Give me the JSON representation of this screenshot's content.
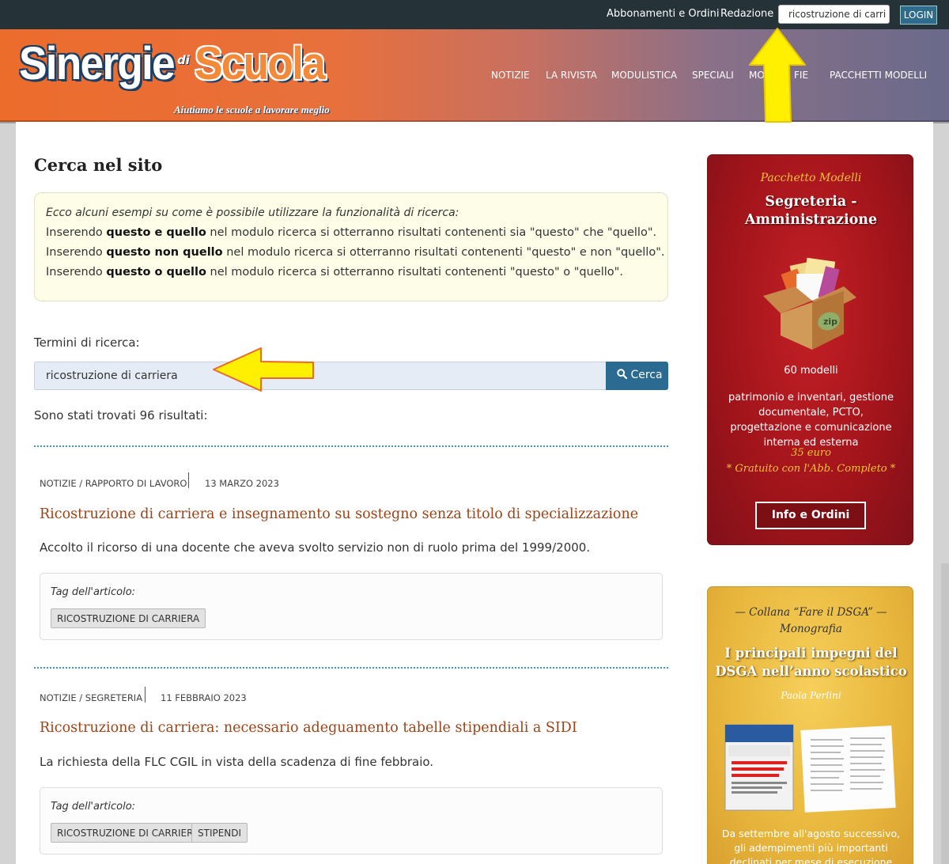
{
  "topbar": {
    "link_subscriptions": "Abbonamenti e Ordini",
    "link_editorial": "Redazione",
    "search_value": "ricostruzione di carri",
    "login_label": "LOGIN"
  },
  "logo": {
    "word1": "Sinergie",
    "word2": "di",
    "word3": "Scuola",
    "tagline": "Aiutiamo le scuole a lavorare meglio"
  },
  "nav": {
    "items": [
      "NOTIZIE",
      "LA RIVISTA",
      "MODULISTICA",
      "SPECIALI",
      "MO",
      "FIE",
      "PACCHETTI MODELLI"
    ]
  },
  "main": {
    "title": "Cerca nel sito",
    "hint": {
      "intro": "Ecco alcuni esempi su come è possibile utilizzare la funzionalità di ricerca:",
      "lines": [
        {
          "pre": "Inserendo ",
          "bold": "questo e quello",
          "post": " nel modulo ricerca si otterranno risultati contenenti sia \"questo\" che \"quello\"."
        },
        {
          "pre": "Inserendo ",
          "bold": "questo non quello",
          "post": " nel modulo ricerca si otterranno risultati contenenti \"questo\" e non \"quello\"."
        },
        {
          "pre": "Inserendo ",
          "bold": "questo o quello",
          "post": " nel modulo ricerca si otterranno risultati contenenti \"questo\" o \"quello\"."
        }
      ]
    },
    "search_label": "Termini di ricerca:",
    "search_value": "ricostruzione di carriera",
    "search_button": "Cerca",
    "results_count": "Sono stati trovati 96 risultati:",
    "results": [
      {
        "category": "NOTIZIE / RAPPORTO DI LAVORO",
        "date": "13 MARZO 2023",
        "title": "Ricostruzione di carriera e insegnamento su sostegno senza titolo di specializzazione",
        "desc": "Accolto il ricorso di una docente che aveva svolto servizio non di ruolo prima del 1999/2000.",
        "tags_label": "Tag dell'articolo:",
        "tags": [
          "RICOSTRUZIONE DI CARRIERA"
        ]
      },
      {
        "category": "NOTIZIE / SEGRETERIA",
        "date": "11 FEBBRAIO 2023",
        "title": "Ricostruzione di carriera: necessario adeguamento tabelle stipendiali a SIDI",
        "desc": "La richiesta della FLC CGIL in vista della scadenza di fine febbraio.",
        "tags_label": "Tag dell'articolo:",
        "tags": [
          "RICOSTRUZIONE DI CARRIERA",
          "STIPENDI"
        ]
      }
    ]
  },
  "sidebar": {
    "ad1": {
      "kicker": "Pacchetto Modelli",
      "title_line1": "Segreteria -",
      "title_line2": "Amministrazione",
      "zip_label": "zip",
      "count": "60 modelli",
      "desc": "patrimonio e inventari, gestione documentale, PCTO, progettazione e comunicazione interna ed esterna",
      "price": "35 euro",
      "price_note": "* Gratuito con l'Abb. Completo *",
      "button": "Info e Ordini"
    },
    "ad2": {
      "kicker_line1": "— Collana “Fare il DSGA” —",
      "kicker_line2": "Monografia",
      "title_line1": "I principali impegni del",
      "title_line2": "DSGA nell’anno scolastico",
      "author": "Paola Perlini",
      "desc": "Da settembre all'agosto successivo, gli adempimenti più importanti declinati per mese di esecuzione"
    }
  },
  "colors": {
    "topbar_bg": "#253238",
    "accent_blue": "#2b6a91",
    "article_title": "#9c4418",
    "annotation_arrow": "#ffef00"
  },
  "icons": {
    "search": "magnifier-icon",
    "arrow": "yellow-arrow-annotation"
  }
}
